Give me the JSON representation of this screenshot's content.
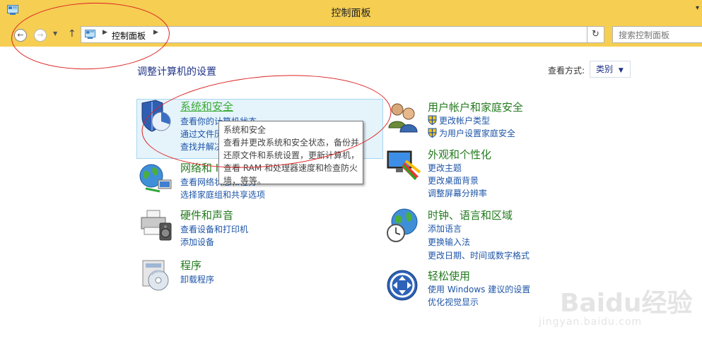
{
  "window": {
    "title": "控制面板",
    "minimize_caret": "▾"
  },
  "address": {
    "path_label": "控制面板",
    "search_placeholder": "搜索控制面板"
  },
  "main": {
    "heading": "调整计算机的设置",
    "view_by_label": "查看方式:",
    "view_by_value": "类别"
  },
  "categories": [
    {
      "title": "系统和安全",
      "links": [
        "查看你的计算机状态",
        "通过文件历史记录保存你的文件备份副本",
        "查找并解决问题"
      ]
    },
    {
      "title": "网络和 Internet",
      "links": [
        "查看网络状态和任务",
        "选择家庭组和共享选项"
      ]
    },
    {
      "title": "硬件和声音",
      "links": [
        "查看设备和打印机",
        "添加设备"
      ]
    },
    {
      "title": "程序",
      "links": [
        "卸载程序"
      ]
    },
    {
      "title": "用户帐户和家庭安全",
      "links": [
        "更改帐户类型",
        "为用户设置家庭安全"
      ]
    },
    {
      "title": "外观和个性化",
      "links": [
        "更改主题",
        "更改桌面背景",
        "调整屏幕分辨率"
      ]
    },
    {
      "title": "时钟、语言和区域",
      "links": [
        "添加语言",
        "更换输入法",
        "更改日期、时间或数字格式"
      ]
    },
    {
      "title": "轻松使用",
      "links": [
        "使用 Windows 建议的设置",
        "优化视觉显示"
      ]
    }
  ],
  "tooltip": {
    "lines": [
      "系统和安全",
      "查看并更改系统和安全状态，备份并",
      "还原文件和系统设置，更新计算机，",
      "查看 RAM 和处理器速度和检查防火",
      "墙，等等。"
    ]
  },
  "watermark": {
    "text": "Baidu经验",
    "sub": "jingyan.baidu.com"
  },
  "colors": {
    "titlebar": "#f5ce52",
    "category_title": "#237a1e",
    "link": "#1e55a8",
    "heading": "#1e3287",
    "annotation": "#dd2222"
  }
}
